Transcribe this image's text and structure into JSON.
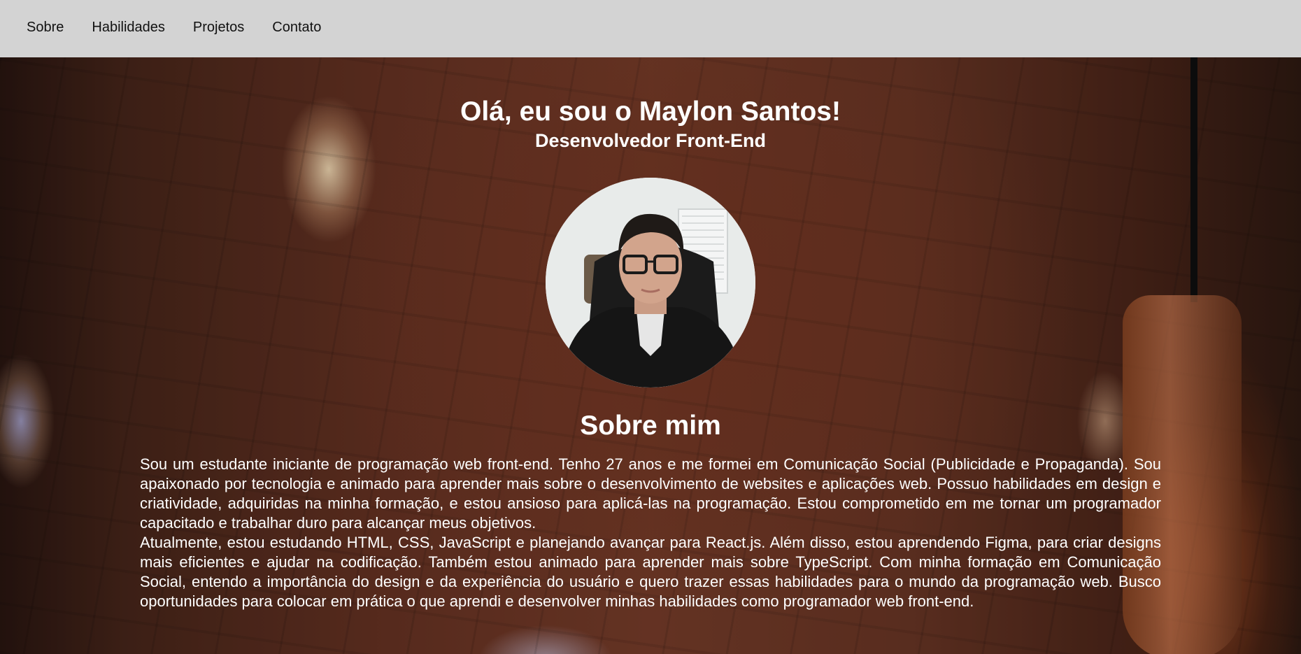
{
  "nav": {
    "items": [
      {
        "label": "Sobre"
      },
      {
        "label": "Habilidades"
      },
      {
        "label": "Projetos"
      },
      {
        "label": "Contato"
      }
    ]
  },
  "hero": {
    "title": "Olá, eu sou o Maylon Santos!",
    "subtitle": "Desenvolvedor Front-End"
  },
  "about": {
    "heading": "Sobre mim",
    "paragraph1": "Sou um estudante iniciante de programação web front-end. Tenho 27 anos e me formei em Comunicação Social (Publicidade e Propaganda). Sou apaixonado por tecnologia e animado para aprender mais sobre o desenvolvimento de websites e aplicações web. Possuo habilidades em design e criatividade, adquiridas na minha formação, e estou ansioso para aplicá-las na programação. Estou comprometido em me tornar um programador capacitado e trabalhar duro para alcançar meus objetivos.",
    "paragraph2": "Atualmente, estou estudando HTML, CSS, JavaScript e planejando avançar para React.js. Além disso, estou aprendendo Figma, para criar designs mais eficientes e ajudar na codificação. Também estou animado para aprender mais sobre TypeScript. Com minha formação em Comunicação Social, entendo a importância do design e da experiência do usuário e quero trazer essas habilidades para o mundo da programação web. Busco oportunidades para colocar em prática o que aprendi e desenvolver minhas habilidades como programador web front-end."
  },
  "colors": {
    "navbar_bg": "#d3d3d3",
    "nav_text": "#111111",
    "hero_text": "#ffffff"
  }
}
